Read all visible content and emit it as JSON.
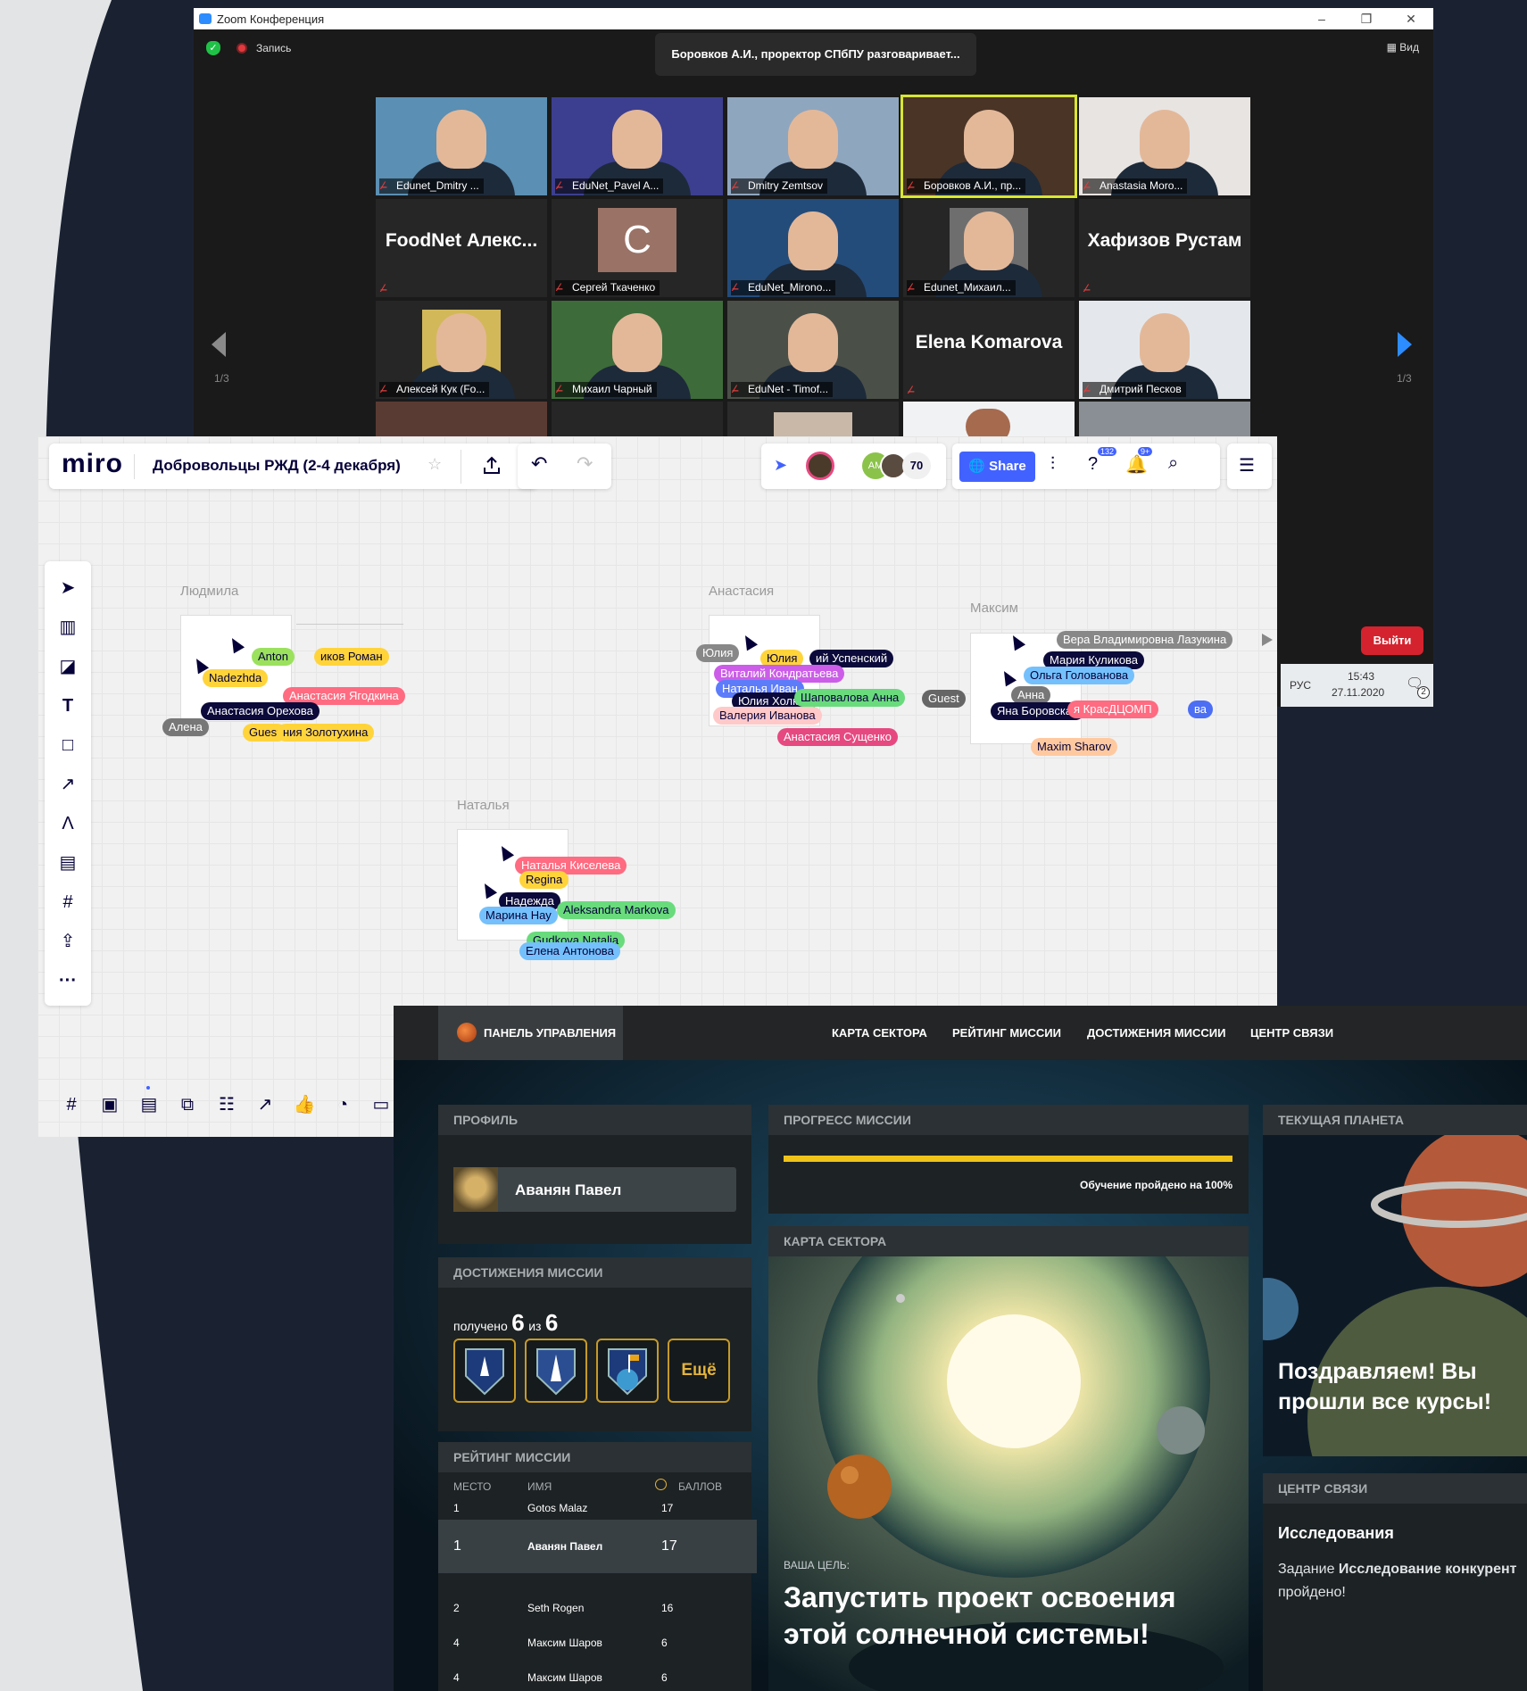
{
  "zoom": {
    "window_title": "Zoom Конференция",
    "recording_label": "Запись",
    "speaker_status": "Боровков А.И., проректор СПбПУ разговаривает...",
    "view_label": "Вид",
    "page_left": "1/3",
    "page_right": "1/3",
    "leave_label": "Выйти",
    "taskbar": {
      "lang": "РУС",
      "time": "15:43",
      "date": "27.11.2020",
      "notif_count": "2"
    },
    "tiles": [
      {
        "name": "Edunet_Dmitry ...",
        "bg": "#5b8fb3",
        "type": "video"
      },
      {
        "name": "EduNet_Pavel A...",
        "bg": "#3c3f8f",
        "type": "video"
      },
      {
        "name": "Dmitry Zemtsov",
        "bg": "#8fa6bf",
        "type": "video"
      },
      {
        "name": "Боровков А.И., пр...",
        "bg": "#4a3426",
        "type": "video",
        "active": true
      },
      {
        "name": "Anastasia Moro...",
        "bg": "#e8e4e2",
        "type": "video"
      },
      {
        "big": "FoodNet  Алекс...",
        "type": "name"
      },
      {
        "name": "Сергей Ткаченко",
        "letter": "C",
        "type": "letter"
      },
      {
        "name": "EduNet_Mirono...",
        "bg": "#244c7a",
        "type": "video"
      },
      {
        "name": "Edunet_Михаил...",
        "bg": "#6e6e6e",
        "type": "avatar"
      },
      {
        "big": "Хафизов Рустам",
        "type": "name"
      },
      {
        "name": "Алексей Кук (Fo...",
        "bg": "#d3b85a",
        "type": "avatar"
      },
      {
        "name": "Михаил Чарный",
        "bg": "#3e6b3a",
        "type": "video"
      },
      {
        "name": "EduNet - Timof...",
        "bg": "#4a5048",
        "type": "video"
      },
      {
        "big": "Elena Komarova",
        "type": "name"
      },
      {
        "name": "Дмитрий Песков",
        "bg": "#e4e8ec",
        "type": "video"
      }
    ]
  },
  "miro": {
    "logo": "miro",
    "board_title": "Добровольцы РЖД (2-4 декабря)",
    "share_label": "Share",
    "collab_initials": "AM",
    "collab_count": "70",
    "help_count": "132",
    "notif_count": "9+",
    "frames": [
      {
        "label": "Людмила"
      },
      {
        "label": "Анастасия"
      },
      {
        "label": "Максим"
      },
      {
        "label": "Наталья"
      }
    ],
    "cursors": [
      {
        "text": "Anton",
        "color": "#9be15d"
      },
      {
        "text": "иков Роман",
        "color": "#ffd43b"
      },
      {
        "text": "Nadezhda",
        "color": "#ffd43b"
      },
      {
        "text": "Анастасия Ягодкина",
        "color": "#ff6b81"
      },
      {
        "text": "Анастасия Орехова",
        "color": "#0b0a3a"
      },
      {
        "text": "Алена",
        "color": "#777777"
      },
      {
        "text": "Guest",
        "color": "#ffd43b"
      },
      {
        "text": "ния Золотухина",
        "color": "#ffd43b"
      },
      {
        "text": "Юлия",
        "color": "#888888"
      },
      {
        "text": "Юлия",
        "color": "#ffd43b"
      },
      {
        "text": "ий Успенский",
        "color": "#0b0a3a"
      },
      {
        "text": "Виталий Кондратьева",
        "color": "#cc5de8"
      },
      {
        "text": "Наталья Иван",
        "color": "#5c7cfa"
      },
      {
        "text": "Юлия Холкин",
        "color": "#0b0a3a"
      },
      {
        "text": "Шаповалова Анна",
        "color": "#69db7c"
      },
      {
        "text": "Guest",
        "color": "#666666"
      },
      {
        "text": "Валерия Иванова",
        "color": "#ffc9c9"
      },
      {
        "text": "Анастасия Сущенко",
        "color": "#e64980"
      },
      {
        "text": "Вера Владимировна Лазукина",
        "color": "#888888"
      },
      {
        "text": "Мария Куликова",
        "color": "#0b0a3a"
      },
      {
        "text": "Ольга Голованова",
        "color": "#74c0fc"
      },
      {
        "text": "Анна",
        "color": "#777777"
      },
      {
        "text": "Яна Боровская",
        "color": "#0b0a3a"
      },
      {
        "text": "я КрасДЦОМП",
        "color": "#ff6b81"
      },
      {
        "text": "ва",
        "color": "#4c6ef5"
      },
      {
        "text": "Maxim Sharov",
        "color": "#ffc9a0"
      },
      {
        "text": "Наталья Киселева",
        "color": "#ff6b81"
      },
      {
        "text": "Regina",
        "color": "#ffd43b"
      },
      {
        "text": "Надежда",
        "color": "#0b0a3a"
      },
      {
        "text": "Марина Нау",
        "color": "#74c0fc"
      },
      {
        "text": "Aleksandra Markova",
        "color": "#69db7c"
      },
      {
        "text": "Gudkova Natalia",
        "color": "#69db7c"
      },
      {
        "text": "Елена Антонова",
        "color": "#74c0fc"
      }
    ]
  },
  "space": {
    "nav": {
      "dashboard": "ПАНЕЛЬ УПРАВЛЕНИЯ",
      "sector_map": "КАРТА СЕКТОРА",
      "rating": "РЕЙТИНГ МИССИИ",
      "achievements": "ДОСТИЖЕНИЯ МИССИИ",
      "comm_center": "ЦЕНТР СВЯЗИ"
    },
    "profile": {
      "header": "ПРОФИЛЬ",
      "name": "Аванян Павел"
    },
    "achievements": {
      "header": "ДОСТИЖЕНИЯ МИССИИ",
      "received_label": "получено",
      "received": "6",
      "of_label": "из",
      "total": "6",
      "more_label": "Ещё"
    },
    "rating": {
      "header": "РЕЙТИНГ МИССИИ",
      "col_place": "МЕСТО",
      "col_name": "ИМЯ",
      "col_points": "БАЛЛОВ",
      "rows": [
        {
          "place": "1",
          "name": "Gotos Malaz",
          "points": "17"
        },
        {
          "place": "1",
          "name": "Аванян Павел",
          "points": "17",
          "highlight": true
        },
        {
          "place": "2",
          "name": "Seth Rogen",
          "points": "16"
        },
        {
          "place": "4",
          "name": "Максим Шаров",
          "points": "6"
        },
        {
          "place": "4",
          "name": "Максим Шаров",
          "points": "6"
        }
      ]
    },
    "progress": {
      "header": "ПРОГРЕСС МИССИИ",
      "value": 1.0,
      "caption": "Обучение пройдено на 100%"
    },
    "sector_map": {
      "header": "КАРТА СЕКТОРА",
      "goal_label": "ВАША ЦЕЛЬ:",
      "goal_line1": "Запустить проект освоения",
      "goal_line2": "этой солнечной системы!"
    },
    "planet": {
      "header": "ТЕКУЩАЯ ПЛАНЕТА",
      "message_line1": "Поздравляем! Вы",
      "message_line2": "прошли все курсы!"
    },
    "comm": {
      "header": "ЦЕНТР СВЯЗИ",
      "title": "Исследования",
      "task_prefix": "Задание",
      "task_name": "Исследование конкурент",
      "task_suffix": "пройдено!"
    }
  }
}
